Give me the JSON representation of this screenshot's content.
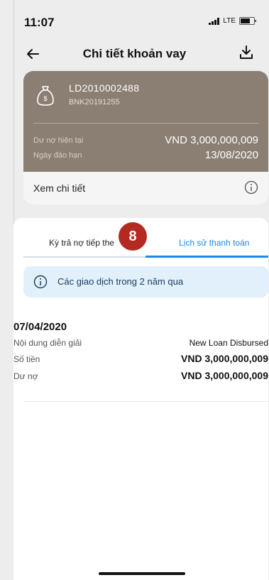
{
  "status_bar": {
    "time": "11:07",
    "network": "LTE"
  },
  "header": {
    "title": "Chi tiết khoản vay"
  },
  "loan_card": {
    "account_number": "LD2010002488",
    "ref_code": "BNK20191255",
    "current_balance_label": "Dư nợ hiện tại",
    "current_balance_value": "VND 3,000,000,009",
    "due_date_label": "Ngày đáo hạn",
    "due_date_value": "13/08/2020",
    "details_link": "Xem chi tiết"
  },
  "tabs": [
    {
      "label": "Kỳ trả nợ tiếp the",
      "active": false
    },
    {
      "label": "Lịch sử thanh toán",
      "active": true
    }
  ],
  "step_badge": "8",
  "info_banner": {
    "text": "Các giao dịch trong 2 năm qua"
  },
  "transactions": [
    {
      "date": "07/04/2020",
      "rows": [
        {
          "label": "Nội dung diễn giải",
          "value": "New Loan Disbursed"
        },
        {
          "label": "Số tiền",
          "value": "VND 3,000,000,009"
        },
        {
          "label": "Dư nợ",
          "value": "VND 3,000,000,009"
        }
      ]
    }
  ],
  "colors": {
    "card_brown": "#8b7f74",
    "accent_blue": "#1e88e5",
    "badge_red": "#b42a22",
    "banner_bg": "#e1f0fb"
  }
}
